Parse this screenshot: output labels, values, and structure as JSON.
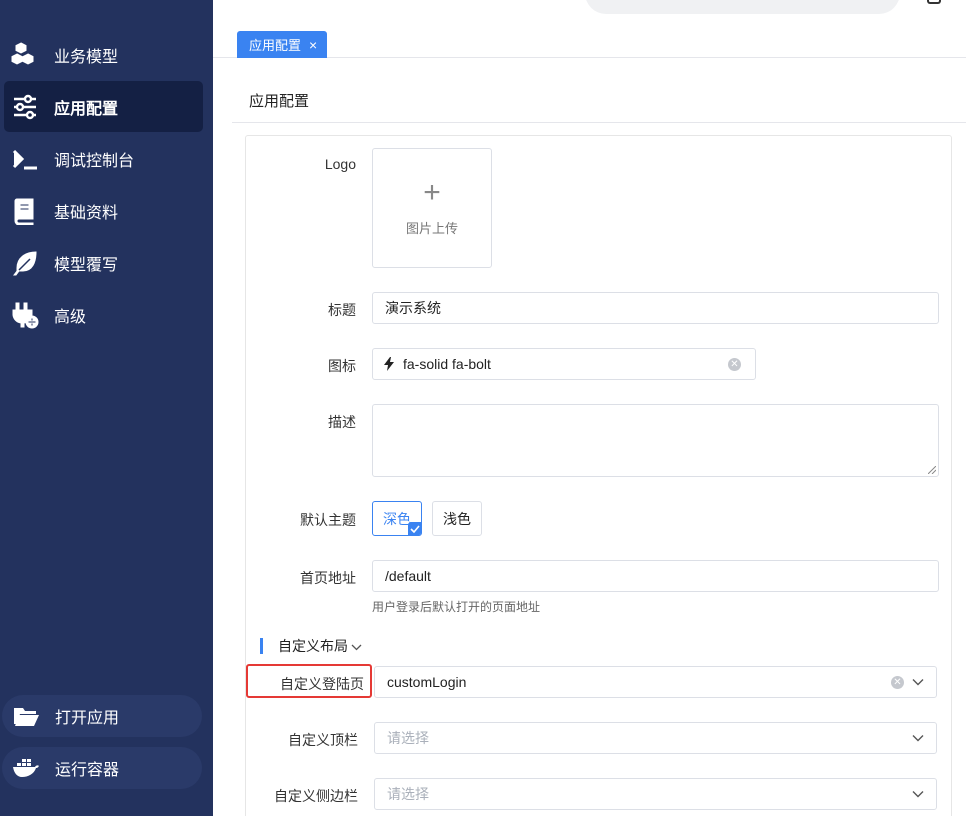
{
  "sidebar": {
    "items": [
      {
        "label": "业务模型",
        "icon": "cubes-icon",
        "active": false
      },
      {
        "label": "应用配置",
        "icon": "sliders-icon",
        "active": true
      },
      {
        "label": "调试控制台",
        "icon": "terminal-icon",
        "active": false
      },
      {
        "label": "基础资料",
        "icon": "book-icon",
        "active": false
      },
      {
        "label": "模型覆写",
        "icon": "feather-icon",
        "active": false
      },
      {
        "label": "高级",
        "icon": "plug-plus-icon",
        "active": false
      }
    ],
    "bottom": [
      {
        "label": "打开应用",
        "icon": "folder-open-icon"
      },
      {
        "label": "运行容器",
        "icon": "docker-icon"
      }
    ]
  },
  "tabs": [
    {
      "label": "应用配置",
      "close": "×"
    }
  ],
  "page": {
    "title": "应用配置"
  },
  "form": {
    "logo_label": "Logo",
    "upload_plus": "+",
    "upload_text": "图片上传",
    "title_label": "标题",
    "title_value": "演示系统",
    "icon_label": "图标",
    "icon_value": "fa-solid fa-bolt",
    "desc_label": "描述",
    "desc_value": "",
    "theme_label": "默认主题",
    "theme_options": [
      "深色",
      "浅色"
    ],
    "theme_selected": "深色",
    "home_label": "首页地址",
    "home_value": "/default",
    "home_hint": "用户登录后默认打开的页面地址",
    "section_title": "自定义布局",
    "login_label": "自定义登陆页",
    "login_value": "customLogin",
    "topbar_label": "自定义顶栏",
    "topbar_placeholder": "请选择",
    "sidebar_label": "自定义侧边栏",
    "sidebar_placeholder": "请选择"
  },
  "colors": {
    "sidebar_bg": "#23325e",
    "sidebar_active": "#142044",
    "accent": "#3a83f1",
    "highlight_box": "#e53935"
  }
}
